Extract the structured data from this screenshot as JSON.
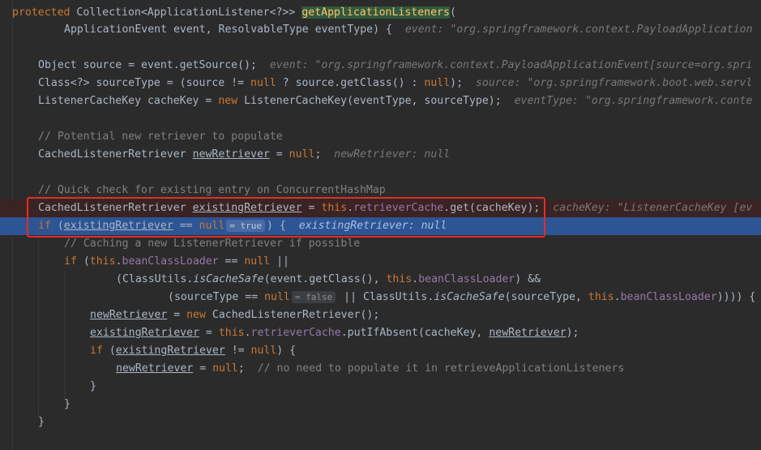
{
  "code": {
    "l1": {
      "kw": "protected",
      "type": "Collection<ApplicationListener<?>>",
      "method": "getApplicationListeners",
      "paren": "("
    },
    "l2": {
      "params": "ApplicationEvent event, ResolvableType eventType) {",
      "hint": "event: \"org.springframework.context.PayloadApplication"
    },
    "l4": {
      "a": "Object source = event.getSource();",
      "hint": "event: \"org.springframework.context.PayloadApplicationEvent[source=org.spri"
    },
    "l5": {
      "a": "Class<?> sourceType = (source != ",
      "null1": "null",
      "b": " ? source.getClass() : ",
      "null2": "null",
      "c": ");",
      "hint": "source: \"org.springframework.boot.web.servl"
    },
    "l6": {
      "a": "ListenerCacheKey cacheKey = ",
      "new": "new",
      "b": " ListenerCacheKey(eventType, sourceType);",
      "hint": "eventType: \"org.springframework.conte"
    },
    "l8": {
      "comment": "// Potential new retriever to populate"
    },
    "l9": {
      "a": "CachedListenerRetriever ",
      "var": "newRetriever",
      "b": " = ",
      "null": "null",
      "c": ";",
      "hint": "newRetriever: null"
    },
    "l11": {
      "comment": "// Quick check for existing entry on ConcurrentHashMap"
    },
    "l12": {
      "a": "CachedListenerRetriever ",
      "var": "existingRetriever",
      "b": " = ",
      "this": "this",
      "dot": ".",
      "field": "retrieverCache",
      "c": ".get(cacheKey);",
      "hint": "cacheKey: \"ListenerCacheKey [ev"
    },
    "l13": {
      "if": "if",
      "a": " (",
      "var": "existingRetriever",
      "b": " == ",
      "null": "null",
      "inlay": "= true",
      "c": ") {",
      "hint": "existingRetriever: null"
    },
    "l14": {
      "comment": "// Caching a new ListenerRetriever if possible"
    },
    "l15": {
      "if": "if",
      "a": " (",
      "this": "this",
      "dot": ".",
      "field": "beanClassLoader",
      "b": " == ",
      "null": "null",
      "c": " ||"
    },
    "l16": {
      "a": "(ClassUtils.",
      "method": "isCacheSafe",
      "b": "(event.getClass(), ",
      "this": "this",
      "dot": ".",
      "field": "beanClassLoader",
      "c": ") &&"
    },
    "l17": {
      "a": "(sourceType == ",
      "null": "null",
      "inlay": "= false",
      "b": " || ClassUtils.",
      "method": "isCacheSafe",
      "c": "(sourceType, ",
      "this": "this",
      "dot": ".",
      "field": "beanClassLoader",
      "d": ")))) {"
    },
    "l18": {
      "var": "newRetriever",
      "a": " = ",
      "new": "new",
      "b": " CachedListenerRetriever();"
    },
    "l19": {
      "var": "existingRetriever",
      "a": " = ",
      "this": "this",
      "dot": ".",
      "field": "retrieverCache",
      "b": ".putIfAbsent(cacheKey, ",
      "var2": "newRetriever",
      "c": ");"
    },
    "l20": {
      "if": "if",
      "a": " (",
      "var": "existingRetriever",
      "b": " != ",
      "null": "null",
      "c": ") {"
    },
    "l21": {
      "var": "newRetriever",
      "a": " = ",
      "null": "null",
      "b": ";",
      "comment": "  // no need to populate it in retrieveApplicationListeners"
    },
    "l22": {
      "brace": "}"
    },
    "l23": {
      "brace": "}"
    },
    "l24": {
      "brace": "}"
    }
  }
}
